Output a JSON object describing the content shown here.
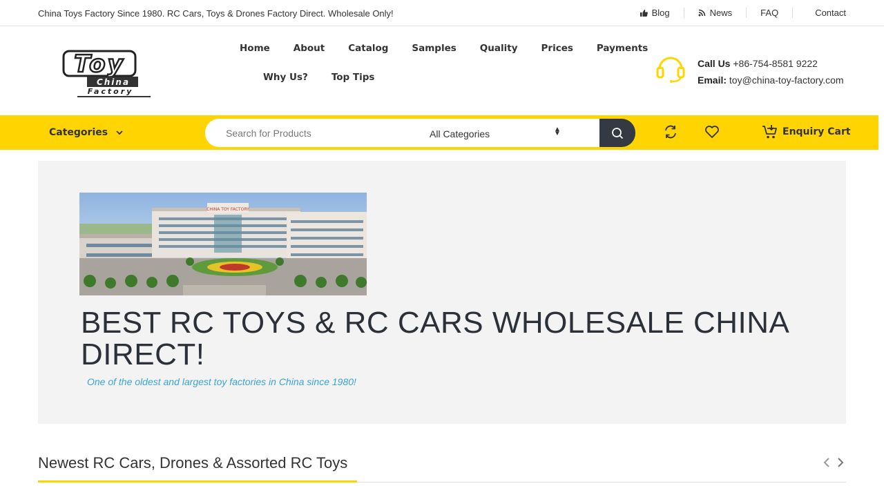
{
  "topbar": {
    "tagline": "China Toys Factory Since 1980. RC Cars, Toys & Drones Factory Direct. Wholesale Only!",
    "links": [
      {
        "label": "Blog",
        "icon": "thumbs-up-icon"
      },
      {
        "label": "News",
        "icon": "rss-icon"
      },
      {
        "label": "FAQ"
      },
      {
        "label": "Contact"
      }
    ]
  },
  "logo": {
    "line1": "Toy",
    "line2": "China",
    "line3": "Factory"
  },
  "nav": {
    "row1": [
      "Home",
      "About",
      "Catalog",
      "Samples",
      "Quality",
      "Prices",
      "Payments"
    ],
    "row2": [
      "Why Us?",
      "Top Tips"
    ]
  },
  "contact": {
    "call_label": "Call Us",
    "phone": "+86-754-8581 9222",
    "email_label": "Email:",
    "email": "toy@china-toy-factory.com"
  },
  "searchbar": {
    "categories_label": "Categories",
    "search_placeholder": "Search for Products",
    "category_select": "All Categories",
    "cart_label": "Enquiry Cart"
  },
  "hero": {
    "photo_sign": "CHINA TOY FACTORY",
    "title": "BEST RC TOYS & RC CARS WHOLESALE CHINA DIRECT!",
    "subtitle": "One of the oldest and largest toy factories in China since 1980!"
  },
  "section": {
    "title": "Newest RC Cars, Drones & Assorted RC Toys"
  },
  "colors": {
    "accent": "#ffd400",
    "dark": "#333a44",
    "link_blue": "#3aa3d8",
    "hero_bg": "#f3f3f3"
  }
}
